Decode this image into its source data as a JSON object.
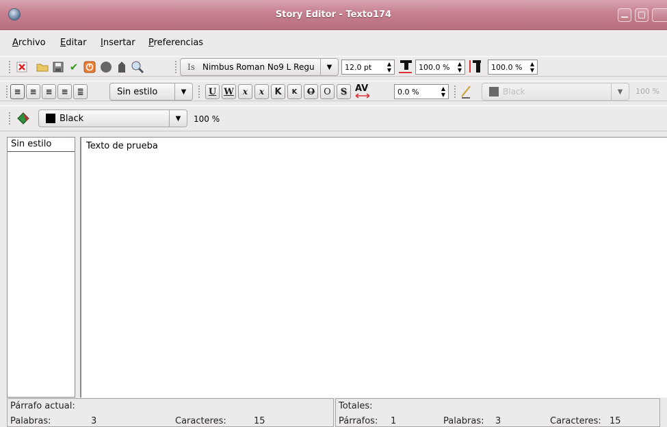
{
  "window": {
    "title": "Story Editor - Texto174",
    "icon": "globe-icon"
  },
  "menu": [
    "Archivo",
    "Editar",
    "Insertar",
    "Preferencias"
  ],
  "toolbar1": {
    "icons": [
      "close-doc-icon",
      "folder-icon",
      "save-icon",
      "check-icon",
      "stop-icon",
      "circle-icon",
      "stamp-icon",
      "search-icon"
    ],
    "font_name": "Nimbus Roman No9 L Regu",
    "font_size": "12.0 pt",
    "scale_width": "100.0 %",
    "scale_height": "100.0 %"
  },
  "toolbar2": {
    "paragraph_style": "Sin estilo",
    "format_buttons": [
      "U",
      "W",
      "x",
      "x",
      "K",
      "K",
      "O",
      "O",
      "S"
    ],
    "tracking": "0.0 %",
    "stroke_color": "Black",
    "stroke_shade": "100 %"
  },
  "toolbar3": {
    "fill_color": "Black",
    "fill_shade": "100 %"
  },
  "style_list": {
    "header": "Sin estilo"
  },
  "editor": {
    "text": "Texto de prueba"
  },
  "status": {
    "current_paragraph": {
      "title": "Párrafo actual:",
      "words_label": "Palabras:",
      "words": "3",
      "chars_label": "Caracteres:",
      "chars": "15"
    },
    "totals": {
      "title": "Totales:",
      "paragraphs_label": "Párrafos:",
      "paragraphs": "1",
      "words_label": "Palabras:",
      "words": "3",
      "chars_label": "Caracteres:",
      "chars": "15"
    }
  },
  "colors": {
    "titlebar": "#c5808f",
    "swatch": "#000000"
  }
}
